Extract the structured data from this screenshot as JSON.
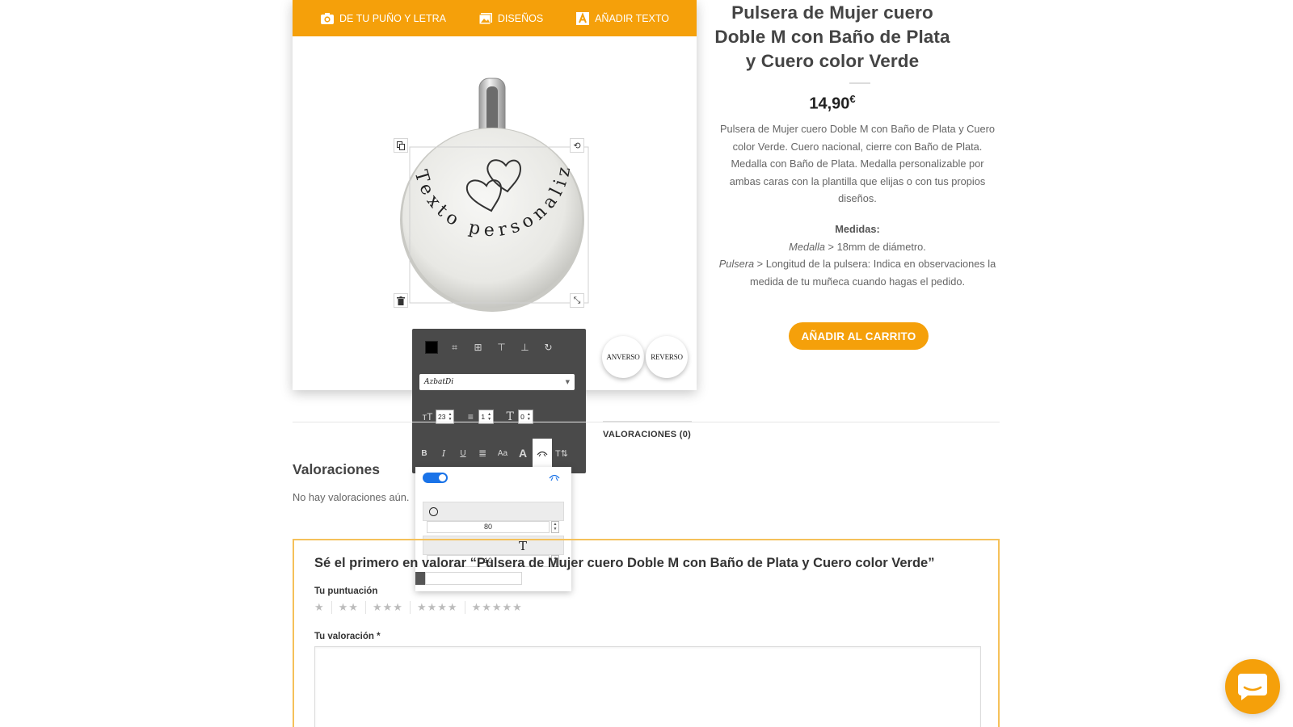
{
  "designer": {
    "toolbar": {
      "handwriting_label": "DE TU PUÑO Y LETRA",
      "designs_label": "DISEÑOS",
      "add_text_label": "AÑADIR TEXTO"
    },
    "medal_text": "Texto personalizado",
    "side_buttons": {
      "front": "ANVERSO",
      "back": "REVERSO"
    },
    "text_tool": {
      "font_name": "AzbatDi",
      "font_size": "23",
      "line_height": "1",
      "letter_spacing": "0",
      "bold_label": "B",
      "italic_label": "I",
      "underline_label": "U",
      "case_label": "Aa"
    },
    "curve_popup": {
      "enabled": true,
      "radius_value": "80",
      "spacing_value": "10"
    }
  },
  "product": {
    "title": "Pulsera de Mujer cuero Doble M con Baño de Plata y Cuero color Verde",
    "price": "14,90",
    "currency": "€",
    "description": "Pulsera de Mujer cuero Doble M con Baño de Plata y Cuero color Verde. Cuero nacional, cierre con Baño de Plata. Medalla con Baño de Plata. Medalla personalizable por ambas caras con la plantilla que elijas o con tus propios diseños.",
    "measures_heading": "Medidas:",
    "medal_label": "Medalla",
    "medal_value": " > 18mm de diámetro.",
    "bracelet_label": "Pulsera",
    "bracelet_value": " > Longitud de la pulsera: Indica en observaciones la medida de tu muñeca cuando hagas el pedido.",
    "add_to_cart": "AÑADIR AL CARRITO"
  },
  "tabs": [
    {
      "label": "VALORACIONES (0)",
      "active": true
    }
  ],
  "reviews": {
    "heading": "Valoraciones",
    "empty_text": "No hay valoraciones aún.",
    "form_title": "Sé el primero en valorar “Pulsera de Mujer cuero Doble M con Baño de Plata y Cuero color Verde”",
    "rating_label": "Tu puntuación",
    "rating_options": [
      "★",
      "★★",
      "★★★",
      "★★★★",
      "★★★★★"
    ],
    "review_label": "Tu valoración *"
  },
  "colors": {
    "accent": "#f5a00a",
    "form_border": "#f5c15a",
    "panel_dark": "#4a4a4a",
    "toggle_on": "#1a73e8"
  }
}
